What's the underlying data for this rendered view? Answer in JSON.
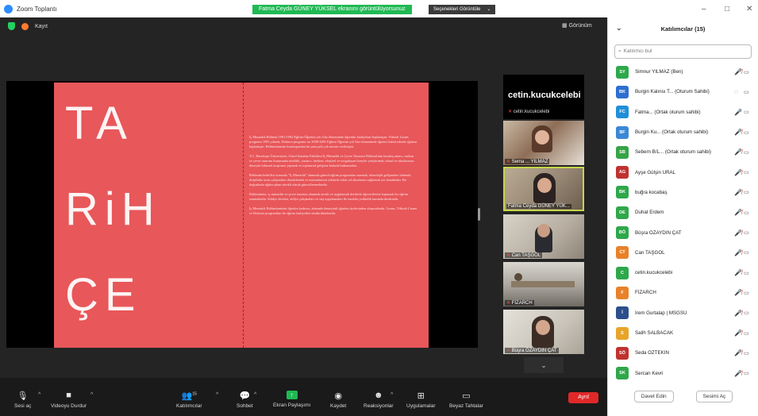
{
  "titlebar": {
    "app_title": "Zoom Toplantı",
    "share_banner": "Fatma Ceyda GÜNEY YÜKSEL ekranını görüntülüyorsunuz",
    "view_options": "Seçenekleri Görüntüle",
    "view_caret": "⌄",
    "minimize": "–",
    "maximize": "□",
    "close": "✕"
  },
  "meeting": {
    "recording_label": "Kayıt",
    "view_label": "Görünüm",
    "slide": {
      "big_lines": [
        "TA",
        "RiH",
        "ÇE"
      ],
      "paragraphs": [
        "İç Mimarlık Bölümü 1991-1992 Eğitim-Öğretim yılı Güz döneminde öğrenim faaliyetine başlamıştır. Yüksek Lisans programı 1995 yılında, Doktora programı ise 2000-2001 Eğitim Öğretim yılı Güz döneminde öğrenci kabul ederek eğitime başlamıştır. Bölümümüzün kuruluşundan bu yana pek çok mezun verilmiştir.",
        "T.C. Hacettepe Üniversitesi, Güzel Sanatlar Fakültesi İç Mimarlık ve Çevre Tasarımı Bölümü'nün kuruluş amacı, mekan ve çevre tasarımı konusunda nitelikli, yaratıcı, üretken, eleştirel ve sorgulayan bireyler yetiştirmek; ulusal ve uluslararası düzeyde bilimsel araştırma yapmak ve toplumsal gelişime katkıda bulunmaktır.",
        "Bölümün hedefleri arasında \"İç Mimarlık\" alanında güncel eğitim programları sunmak, teknolojik gelişmeleri izlemek, disiplinler arası çalışmaları desteklemek ve mezunlarının sektörde etkin rol almalarını sağlamak yer almaktadır. Bu doğrultuda eğitim planı sürekli olarak güncellenmektedir.",
        "Bölümümüz, iç mimarlık ve çevre tasarımı alanında teorik ve uygulamalı derslerle öğrencilerine kapsamlı bir eğitim sunmaktadır. Stüdyo dersleri, atölye çalışmaları ve staj uygulamaları ile mesleki yetkinlik kazandırılmaktadır.",
        "İç Mimarlık Bölümümüzün öğretim kadrosu, alanında deneyimli öğretim üyelerinden oluşmaktadır. Lisans, Yüksek Lisans ve Doktora programları ile eğitim faaliyetleri sürdürülmektedir."
      ]
    },
    "host_tile": {
      "name": "cetin.kucukcelebi",
      "sub": "cetin.kucukcelebi"
    },
    "video_tiles": [
      {
        "name": "Sema ... YILMAZ"
      },
      {
        "name": "Fatma Ceyda GÜNEY YÜK..."
      },
      {
        "name": "Can TAŞGÖL"
      },
      {
        "name": "FİZARCH"
      },
      {
        "name": "Büşra ÖZAYDIN ÇAT"
      }
    ],
    "scroll_down": "⌄"
  },
  "toolbar": {
    "mute": "Sesi aç",
    "video": "Videoyu Durdur",
    "participants": "Katılımcılar",
    "participants_count": "15",
    "chat": "Sohbet",
    "share": "Ekran Paylaşımı",
    "record": "Kaydet",
    "reactions": "Reaksiyonlar",
    "apps": "Uygulamalar",
    "whiteboard": "Beyaz Tahtalar",
    "leave": "Ayrıl"
  },
  "panel": {
    "title": "Katılımcılar (15)",
    "search_placeholder": "Katılımcı bul",
    "participants": [
      {
        "initials": "SY",
        "color": "#2ea84b",
        "name": "Simnur YILMAZ (Ben)",
        "mic": "muted",
        "mic_icon": "🎤̸",
        "cam_icon": "▭"
      },
      {
        "initials": "BK",
        "color": "#2d6fd0",
        "name": "Burgin Kalınsı T...  (Oturum Sahibi)",
        "mic": "normal",
        "mic_icon": "◌",
        "cam_icon": "▭"
      },
      {
        "initials": "FC",
        "color": "#1f8fd8",
        "name": "Fatma... (Ortak oturum sahibi)",
        "mic": "normal",
        "mic_icon": "🎤",
        "cam_icon": "▭"
      },
      {
        "initials": "BF",
        "color": "#3b88d6",
        "name": "Burgin Ku...  (Ortak oturum sahibi)",
        "mic": "muted",
        "mic_icon": "🎤̸",
        "cam_icon": "▭"
      },
      {
        "initials": "SB",
        "color": "#36a447",
        "name": "Sebern B/L... (Ortak oturum sahibi)",
        "mic": "muted",
        "mic_icon": "🎤̸",
        "cam_icon": "▭"
      },
      {
        "initials": "AG",
        "color": "#c0322e",
        "name": "Ayşe Gülşin URAL",
        "mic": "muted",
        "mic_icon": "🎤̸",
        "cam_icon": "▭"
      },
      {
        "initials": "BK",
        "color": "#2ea84b",
        "name": "buğra kocabaş",
        "mic": "muted",
        "mic_icon": "🎤̸",
        "cam_icon": "▭"
      },
      {
        "initials": "DE",
        "color": "#30a74a",
        "name": "Duhat Erdem",
        "mic": "muted",
        "mic_icon": "🎤̸",
        "cam_icon": "▭"
      },
      {
        "initials": "BÖ",
        "color": "#2ea84b",
        "name": "Büşra ÖZAYDIN ÇAT",
        "mic": "muted",
        "mic_icon": "🎤̸",
        "cam_icon": "▭"
      },
      {
        "initials": "CT",
        "color": "#e8822a",
        "name": "Can TAŞGÖL",
        "mic": "muted",
        "mic_icon": "🎤̸",
        "cam_icon": "▭"
      },
      {
        "initials": "C",
        "color": "#2ea84b",
        "name": "cetin.kucukcelebi",
        "mic": "muted",
        "mic_icon": "🎤̸",
        "cam_icon": "▭"
      },
      {
        "initials": "F",
        "color": "#e8822a",
        "name": "FİZARCH",
        "mic": "muted",
        "mic_icon": "🎤̸",
        "cam_icon": "▭"
      },
      {
        "initials": "İ",
        "color": "#2c4f8c",
        "name": "İrem Gurtalap | MSGSÜ",
        "mic": "muted",
        "mic_icon": "🎤̸",
        "cam_icon": "▭"
      },
      {
        "initials": "S",
        "color": "#e8a42a",
        "name": "Salih SALBACAK",
        "mic": "muted",
        "mic_icon": "🎤̸",
        "cam_icon": "▭"
      },
      {
        "initials": "SÖ",
        "color": "#c0322e",
        "name": "Seda ÖZTEKİN",
        "mic": "muted",
        "mic_icon": "🎤̸",
        "cam_icon": "▭"
      },
      {
        "initials": "SK",
        "color": "#30a74a",
        "name": "Sercan Kevri",
        "mic": "muted",
        "mic_icon": "🎤̸",
        "cam_icon": "▭"
      }
    ],
    "invite": "Davet Edin",
    "unmute_me": "Sesimi Aç"
  }
}
